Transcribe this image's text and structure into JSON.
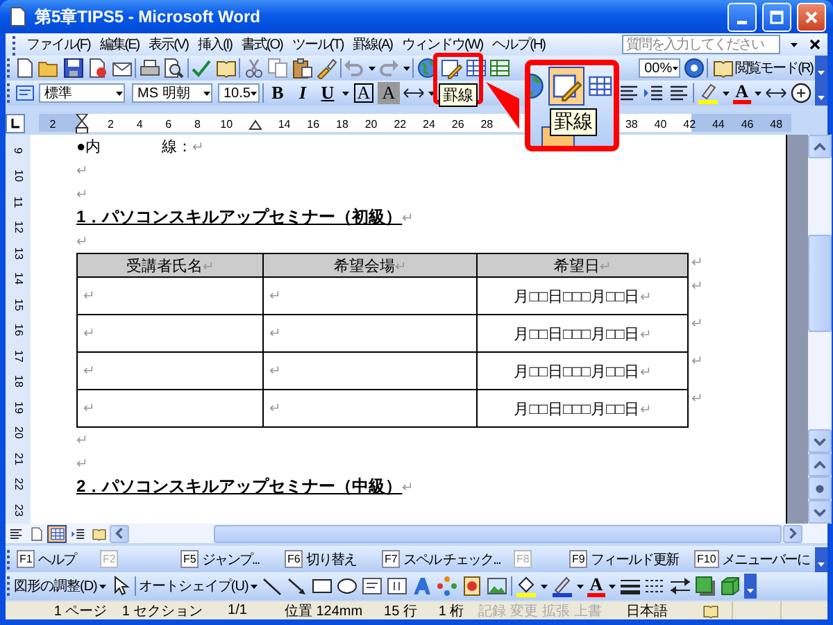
{
  "window": {
    "title": "第5章TIPS5 - Microsoft Word"
  },
  "menu": {
    "items": [
      "ファイル(F)",
      "編集(E)",
      "表示(V)",
      "挿入(I)",
      "書式(O)",
      "ツール(T)",
      "罫線(A)",
      "ウィンドウ(W)",
      "ヘルプ(H)"
    ],
    "help_placeholder": "質問を入力してください"
  },
  "standard_toolbar": {
    "zoom": "00%",
    "reading_mode": "閲覧モード(R)"
  },
  "formatting_toolbar": {
    "style": "標準",
    "font": "MS 明朝",
    "size": "10.5",
    "text_buttons": [
      {
        "label": "B",
        "kind": "bold"
      },
      {
        "label": "I",
        "kind": "italic"
      },
      {
        "label": "U",
        "kind": "underline"
      },
      {
        "label": "A",
        "kind": "boxed"
      },
      {
        "label": "A",
        "kind": "shaded"
      }
    ],
    "font_color_label": "A"
  },
  "ruler": {
    "groups": [
      [
        "2"
      ],
      [
        "2",
        "4",
        "6",
        "8",
        "10"
      ],
      [
        "14",
        "16",
        "18",
        "20",
        "22",
        "24",
        "26",
        "28"
      ],
      [
        "38",
        "40",
        "42",
        "44",
        "46",
        "48"
      ]
    ]
  },
  "vertical_ruler": [
    "9",
    "10",
    "11",
    "12",
    "13",
    "14",
    "15",
    "16",
    "17",
    "18",
    "19",
    "20",
    "21",
    "22",
    "23"
  ],
  "document": {
    "blocks": [
      {
        "kind": "text",
        "text": "●内　　　　線：",
        "mark": "↵"
      },
      {
        "kind": "blank",
        "mark": "↵"
      },
      {
        "kind": "blank",
        "mark": "↵"
      },
      {
        "kind": "heading",
        "text": "1．パソコンスキルアップセミナー（初級）",
        "mark": "↵"
      },
      {
        "kind": "blank",
        "mark": "↵"
      },
      {
        "kind": "table",
        "header": [
          {
            "text": "受講者氏名",
            "mark": "↵"
          },
          {
            "text": "希望会場",
            "mark": "↵"
          },
          {
            "text": "希望日",
            "mark": "↵"
          }
        ],
        "header_end": "↵",
        "rows": [
          {
            "cells": [
              {
                "mark": "↵"
              },
              {
                "mark": "↵"
              },
              {
                "text": "月□□日□□□月□□日",
                "mark": "↵"
              }
            ],
            "end": "↵"
          },
          {
            "cells": [
              {
                "mark": "↵"
              },
              {
                "mark": "↵"
              },
              {
                "text": "月□□日□□□月□□日",
                "mark": "↵"
              }
            ],
            "end": "↵"
          },
          {
            "cells": [
              {
                "mark": "↵"
              },
              {
                "mark": "↵"
              },
              {
                "text": "月□□日□□□月□□日",
                "mark": "↵"
              }
            ],
            "end": "↵"
          },
          {
            "cells": [
              {
                "mark": "↵"
              },
              {
                "mark": "↵"
              },
              {
                "text": "月□□日□□□月□□日",
                "mark": "↵"
              }
            ],
            "end": "↵"
          }
        ]
      },
      {
        "kind": "blank",
        "mark": "↵"
      },
      {
        "kind": "blank",
        "mark": "↵"
      },
      {
        "kind": "heading",
        "text": "2．パソコンスキルアップセミナー（中級）",
        "mark": "↵"
      }
    ]
  },
  "view_modes": [
    {
      "selected": false
    },
    {
      "selected": false
    },
    {
      "selected": true
    },
    {
      "selected": false
    },
    {
      "selected": false
    }
  ],
  "callout": {
    "tooltip": "罫線",
    "zoom_tooltip": "罫線"
  },
  "function_keys": [
    {
      "key": "F1",
      "label": "ヘルプ",
      "disabled": false
    },
    {
      "key": "F2",
      "disabled": true
    },
    {
      "key": "F5",
      "label": "ジャンプ...",
      "disabled": false
    },
    {
      "key": "F6",
      "label": "切り替え",
      "disabled": false
    },
    {
      "key": "F7",
      "label": "スペル チェック...",
      "disabled": false
    },
    {
      "key": "F8",
      "disabled": true
    },
    {
      "key": "F9",
      "label": "フィールド更新",
      "disabled": false
    },
    {
      "key": "F10",
      "label": "メニューバーに",
      "disabled": false
    }
  ],
  "drawing_toolbar": {
    "draw_menu": "図形の調整(D)",
    "autoshapes": "オートシェイプ(U)",
    "font_color_label": "A"
  },
  "status_bar": [
    {
      "text": "1 ページ",
      "disabled": false
    },
    {
      "text": "1 セクション",
      "disabled": false
    },
    {
      "text": "1/1",
      "disabled": false
    },
    {
      "text": "位置 124mm",
      "disabled": false
    },
    {
      "text": "15 行",
      "disabled": false
    },
    {
      "text": "1 桁",
      "disabled": false
    },
    {
      "text": "記録",
      "disabled": true
    },
    {
      "text": "変更",
      "disabled": true
    },
    {
      "text": "拡張",
      "disabled": true
    },
    {
      "text": "上書",
      "disabled": true
    },
    {
      "text": "日本語",
      "disabled": false
    }
  ]
}
